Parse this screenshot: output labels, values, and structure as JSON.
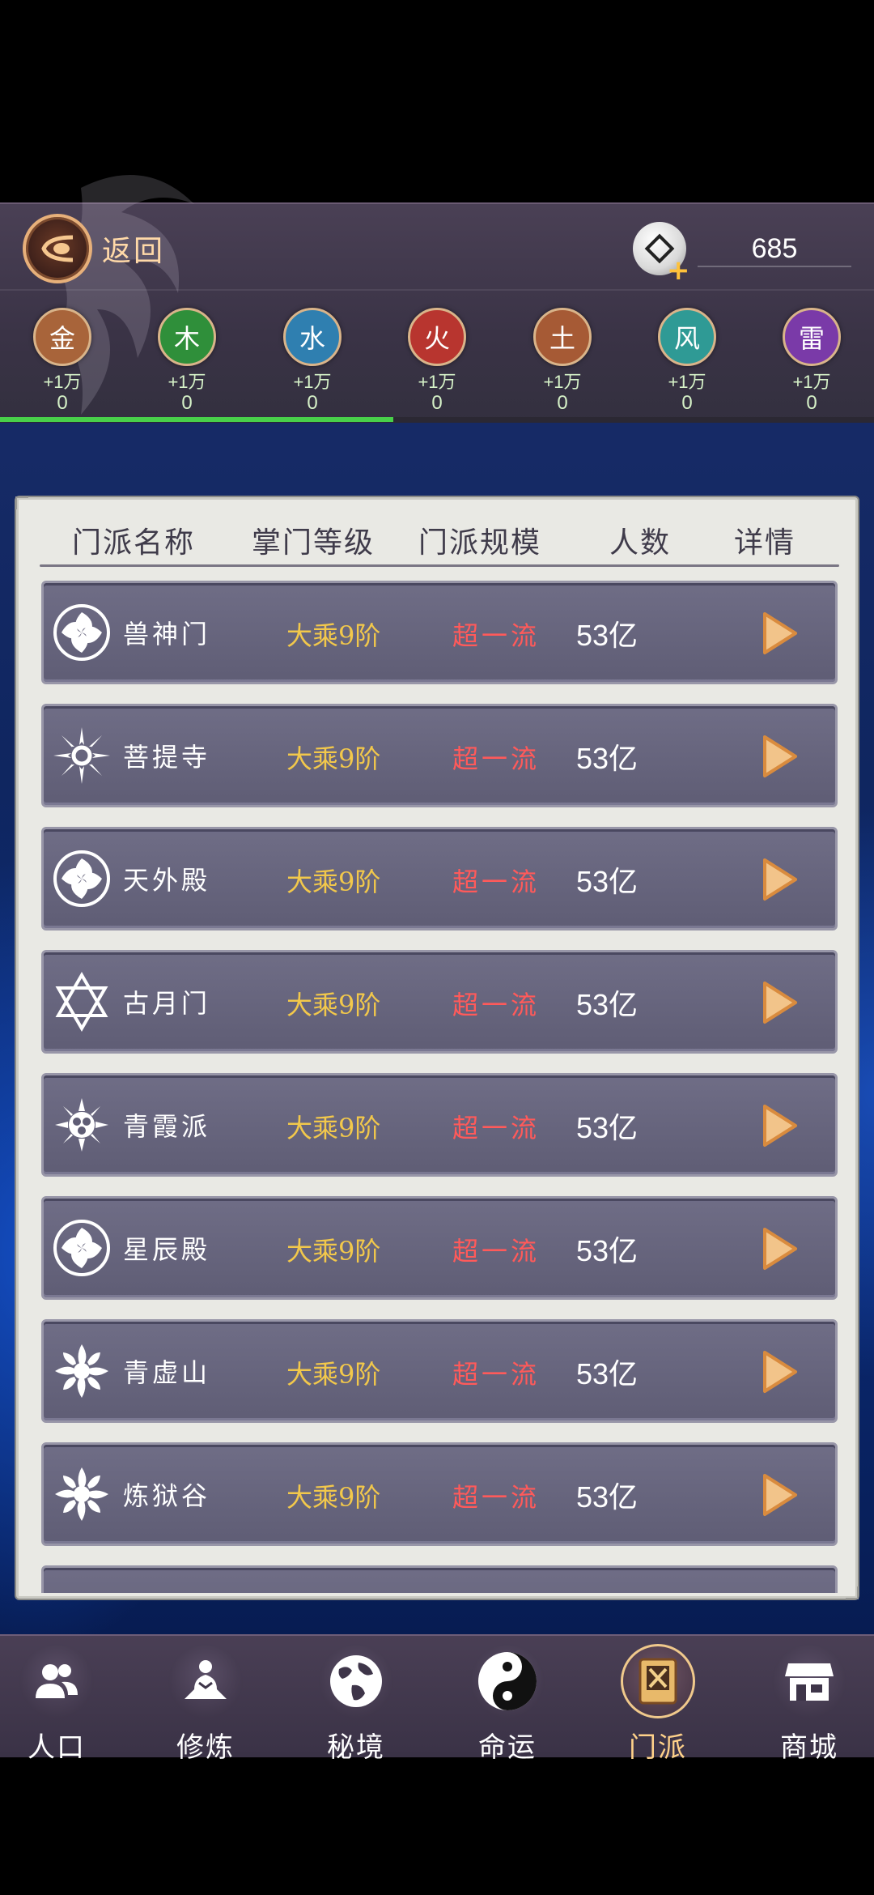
{
  "header": {
    "back_label": "返回",
    "currency_value": "685"
  },
  "elements": [
    {
      "name": "金",
      "bonus": "+1万",
      "count": "0",
      "color": "#a8643a"
    },
    {
      "name": "木",
      "bonus": "+1万",
      "count": "0",
      "color": "#2f8f3a"
    },
    {
      "name": "水",
      "bonus": "+1万",
      "count": "0",
      "color": "#2f7fb0"
    },
    {
      "name": "火",
      "bonus": "+1万",
      "count": "0",
      "color": "#b8352f"
    },
    {
      "name": "土",
      "bonus": "+1万",
      "count": "0",
      "color": "#a65a35"
    },
    {
      "name": "风",
      "bonus": "+1万",
      "count": "0",
      "color": "#2f9a95"
    },
    {
      "name": "雷",
      "bonus": "+1万",
      "count": "0",
      "color": "#7a3aa8"
    }
  ],
  "progress": {
    "fraction": 0.45,
    "color": "#48d04a"
  },
  "table": {
    "headers": {
      "name": "门派名称",
      "level": "掌门等级",
      "scale": "门派规模",
      "count": "人数",
      "detail": "详情"
    },
    "rows": [
      {
        "name": "兽神门",
        "level": "大乘9阶",
        "scale": "超一流",
        "count": "53亿",
        "emblem": "swirl-emblem-icon"
      },
      {
        "name": "菩提寺",
        "level": "大乘9阶",
        "scale": "超一流",
        "count": "53亿",
        "emblem": "sunburst-emblem-icon"
      },
      {
        "name": "天外殿",
        "level": "大乘9阶",
        "scale": "超一流",
        "count": "53亿",
        "emblem": "swirl-emblem-icon"
      },
      {
        "name": "古月门",
        "level": "大乘9阶",
        "scale": "超一流",
        "count": "53亿",
        "emblem": "hexagram-emblem-icon"
      },
      {
        "name": "青霞派",
        "level": "大乘9阶",
        "scale": "超一流",
        "count": "53亿",
        "emblem": "flower-emblem-icon"
      },
      {
        "name": "星辰殿",
        "level": "大乘9阶",
        "scale": "超一流",
        "count": "53亿",
        "emblem": "swirl-emblem-icon"
      },
      {
        "name": "青虚山",
        "level": "大乘9阶",
        "scale": "超一流",
        "count": "53亿",
        "emblem": "spiral-emblem-icon"
      },
      {
        "name": "炼狱谷",
        "level": "大乘9阶",
        "scale": "超一流",
        "count": "53亿",
        "emblem": "spiral-emblem-icon"
      }
    ]
  },
  "nav": {
    "items": [
      {
        "label": "人口",
        "icon": "people-icon",
        "active": false
      },
      {
        "label": "修炼",
        "icon": "meditation-icon",
        "active": false
      },
      {
        "label": "秘境",
        "icon": "globe-icon",
        "active": false
      },
      {
        "label": "命运",
        "icon": "yin-yang-icon",
        "active": false
      },
      {
        "label": "门派",
        "icon": "sect-book-icon",
        "active": true
      },
      {
        "label": "商城",
        "icon": "shop-icon",
        "active": false
      }
    ]
  }
}
